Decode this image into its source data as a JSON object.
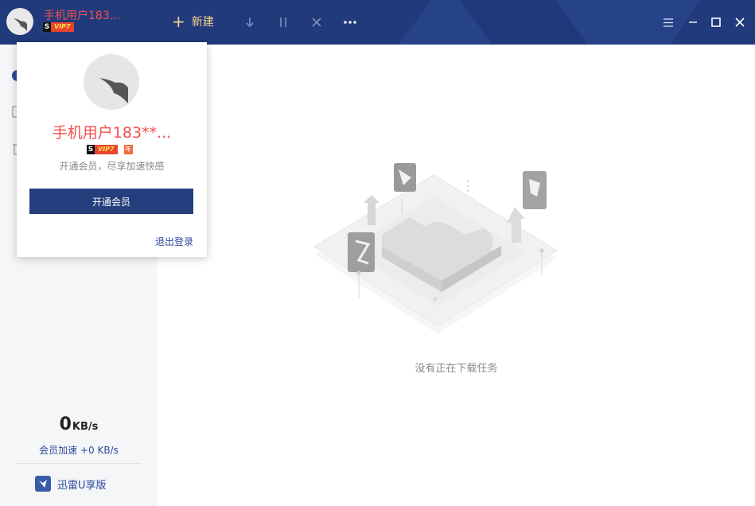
{
  "header": {
    "user_name": "手机用户183...",
    "vip_badge": "VIP7",
    "new_label": "新建"
  },
  "popup": {
    "user_name": "手机用户183**...",
    "vip_badge": "VIP7",
    "year_badge": "年",
    "tip": "开通会员，尽享加速快感",
    "open_vip_button": "开通会员",
    "logout_link": "退出登录"
  },
  "sidebar": {
    "speed_value": "0",
    "speed_unit": "KB/s",
    "boost_text": "会员加速 +0 KB/s",
    "u_edition": "迅雷U享版"
  },
  "main": {
    "empty_text": "没有正在下载任务"
  },
  "colors": {
    "header_bg": "#213a7c",
    "accent_red": "#f0504d",
    "accent_gold": "#f5d28a",
    "sidebar_bg": "#f5f6f8",
    "button_bg": "#243e7e"
  }
}
